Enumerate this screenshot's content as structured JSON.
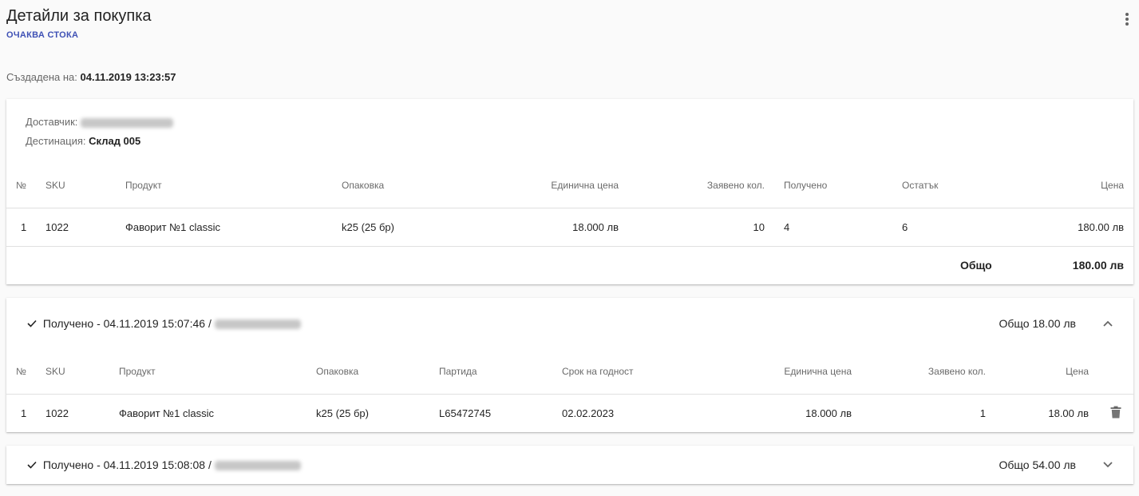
{
  "header": {
    "title": "Детайли за покупка",
    "status": "ОЧАКВА СТОКА"
  },
  "created": {
    "label": "Създадена на:",
    "value": "04.11.2019 13:23:57"
  },
  "order": {
    "supplier_label": "Доставчик:",
    "destination_label": "Дестинация:",
    "destination_value": "Склад 005",
    "columns": [
      "№",
      "SKU",
      "Продукт",
      "Опаковка",
      "Единична цена",
      "Заявено кол.",
      "Получено",
      "Остатък",
      "Цена"
    ],
    "rows": [
      {
        "no": "1",
        "sku": "1022",
        "product": "Фаворит №1 classic",
        "package": "k25 (25 бр)",
        "unit_price": "18.000 лв",
        "requested": "10",
        "received": "4",
        "remaining": "6",
        "price": "180.00 лв"
      }
    ],
    "total_label": "Общо",
    "total_value": "180.00 лв"
  },
  "receipts": [
    {
      "title": "Получено - 04.11.2019 15:07:46 /",
      "total": "Общо 18.00 лв",
      "expanded": true,
      "columns": [
        "№",
        "SKU",
        "Продукт",
        "Опаковка",
        "Партида",
        "Срок на годност",
        "Единична цена",
        "Заявено кол.",
        "Цена"
      ],
      "rows": [
        {
          "no": "1",
          "sku": "1022",
          "product": "Фаворит №1 classic",
          "package": "k25 (25 бр)",
          "batch": "L65472745",
          "expiry": "02.02.2023",
          "unit_price": "18.000 лв",
          "requested": "1",
          "price": "18.00 лв"
        }
      ]
    },
    {
      "title": "Получено - 04.11.2019 15:08:08 /",
      "total": "Общо 54.00 лв",
      "expanded": false
    }
  ],
  "icons": {
    "more": "more-vert-icon",
    "check": "check-icon",
    "expand_less": "chevron-up-icon",
    "expand_more": "chevron-down-icon",
    "delete": "trash-icon"
  },
  "colors": {
    "accent": "#3f51b5",
    "background": "#fafafa"
  }
}
